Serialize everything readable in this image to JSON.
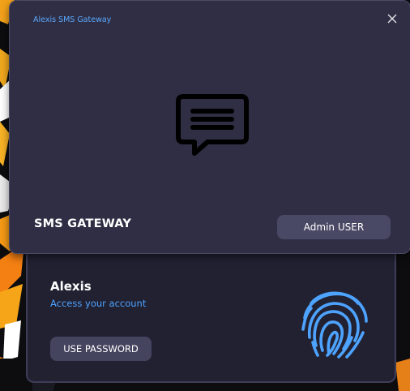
{
  "window": {
    "title": "Alexis SMS Gateway",
    "close_icon": "close-icon"
  },
  "hero": {
    "logo_icon": "chat-message-icon",
    "brand_text": "SMS GATEWAY",
    "admin_button_label": "Admin USER"
  },
  "account": {
    "user_name": "Alexis",
    "subtitle": "Access your account",
    "password_button_label": "USE PASSWORD",
    "fingerprint_icon": "fingerprint-icon"
  },
  "colors": {
    "accent_blue": "#4da3ff",
    "card_top": "#2f2e44",
    "card_bottom": "#222132",
    "button": "#4a4965"
  }
}
